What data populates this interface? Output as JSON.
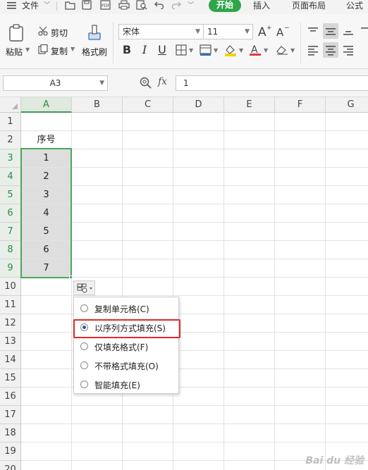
{
  "tabbar": {
    "menu_label": "文件",
    "tabs": [
      "开始",
      "插入",
      "页面布局",
      "公式"
    ]
  },
  "ribbon": {
    "paste_label": "粘贴",
    "cut_label": "剪切",
    "copy_label": "复制",
    "format_painter_label": "格式刷",
    "font_name": "宋体",
    "font_size": "11",
    "font_color": "#e03a3a",
    "fill_color": "#f3d400"
  },
  "formula_bar": {
    "cell_ref": "A3",
    "fx_label": "fx",
    "formula_value": "1"
  },
  "grid": {
    "columns": [
      "A",
      "B",
      "C",
      "D",
      "E",
      "F",
      "G"
    ],
    "rows": [
      "1",
      "2",
      "3",
      "4",
      "5",
      "6",
      "7",
      "8",
      "9",
      "10",
      "11",
      "12",
      "13",
      "14",
      "15",
      "16",
      "17",
      "18",
      "19",
      "20"
    ],
    "header_cell": "序号",
    "values": [
      "1",
      "2",
      "3",
      "4",
      "5",
      "6",
      "7"
    ],
    "selection_color": "#4aa85c"
  },
  "autofill_menu": {
    "options": [
      {
        "label": "复制单元格(C)",
        "checked": false
      },
      {
        "label": "以序列方式填充(S)",
        "checked": true
      },
      {
        "label": "仅填充格式(F)",
        "checked": false
      },
      {
        "label": "不带格式填充(O)",
        "checked": false
      },
      {
        "label": "智能填充(E)",
        "checked": false
      }
    ]
  },
  "watermark": "Bai du 经验"
}
